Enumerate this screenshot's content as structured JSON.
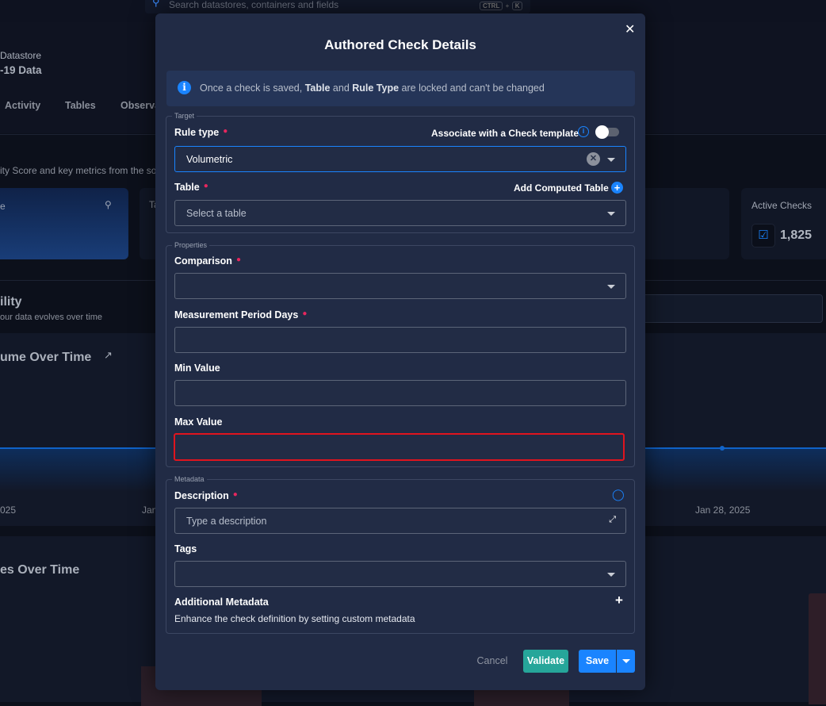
{
  "background": {
    "search_placeholder": "Search datastores, containers and fields",
    "shortcut": [
      "CTRL",
      "+",
      "K"
    ],
    "datastore_label": "Datastore",
    "datastore_name": "-19 Data",
    "tabs": [
      "Activity",
      "Tables",
      "Observa"
    ],
    "subtitle": "ity Score and key metrics from the so",
    "score_card_label": "e",
    "card2_label": "Ta",
    "active_checks_label": "Active Checks",
    "active_checks_value": "1,825",
    "section_title": "ility",
    "section_subtitle": "our data evolves over time",
    "chart1_title": "ume Over Time",
    "chart1_dates": [
      "025",
      "Jan",
      "Jan 28, 2025"
    ],
    "chart2_title": "es Over Time"
  },
  "modal": {
    "title": "Authored Check Details",
    "info_pre": "Once a check is saved, ",
    "info_b1": "Table",
    "info_mid": " and ",
    "info_b2": "Rule Type",
    "info_post": " are locked and can't be changed",
    "target": {
      "legend": "Target",
      "rule_type_label": "Rule type",
      "template_label": "Associate with a Check template",
      "template_enabled": false,
      "rule_type_value": "Volumetric",
      "table_label": "Table",
      "add_computed_label": "Add Computed Table",
      "table_placeholder": "Select a table"
    },
    "properties": {
      "legend": "Properties",
      "comparison_label": "Comparison",
      "comparison_value": "",
      "period_label": "Measurement Period Days",
      "period_value": "",
      "min_label": "Min Value",
      "min_value": "",
      "max_label": "Max Value",
      "max_value": ""
    },
    "metadata": {
      "legend": "Metadata",
      "description_label": "Description",
      "description_placeholder": "Type a description",
      "tags_label": "Tags",
      "additional_title": "Additional Metadata",
      "additional_desc": "Enhance the check definition by setting custom metadata"
    },
    "buttons": {
      "cancel": "Cancel",
      "validate": "Validate",
      "save": "Save"
    },
    "colors": {
      "accent": "#1a84ff",
      "validate": "#26a69a",
      "required": "#e8265e",
      "highlight": "#e0141e"
    }
  }
}
